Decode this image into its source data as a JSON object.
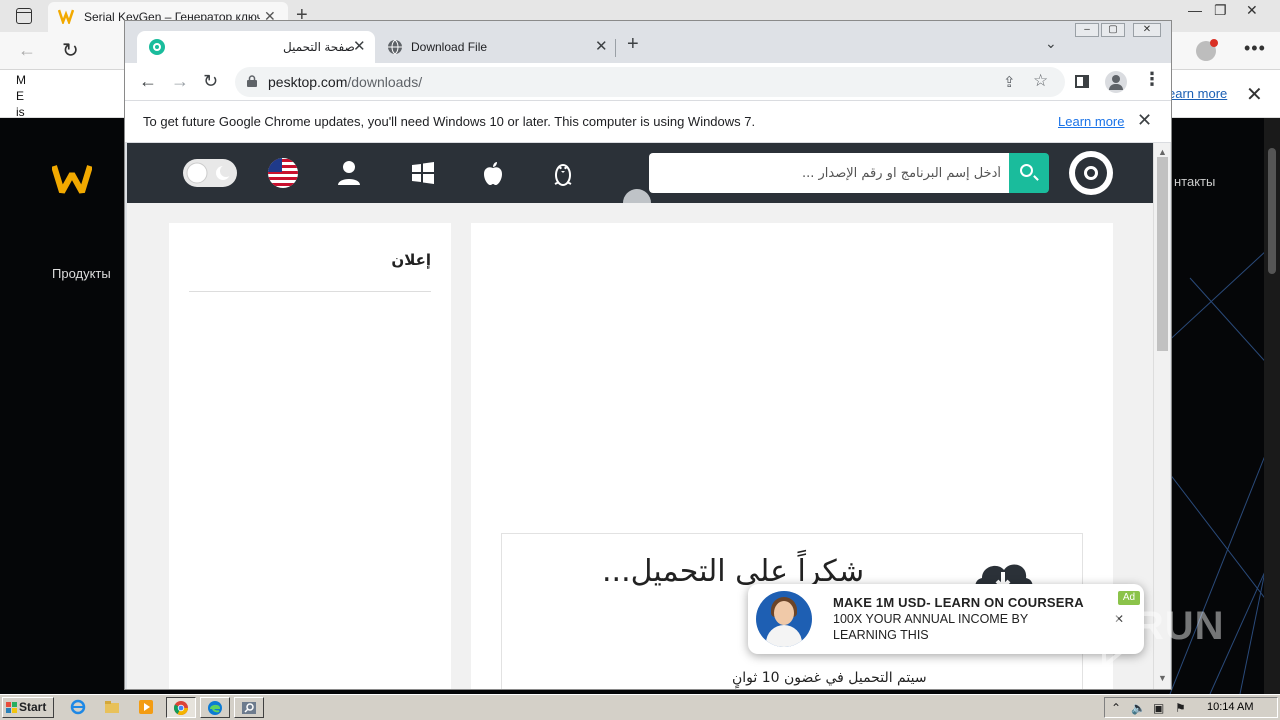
{
  "background_window": {
    "tab_title": "Serial KeyGen – Генератор ключ",
    "infobar_fragment": "M E is",
    "infobar_learn_more": "earn more",
    "nav_products": "Продукты",
    "nav_contacts": "нтакты"
  },
  "chrome": {
    "tabs": [
      {
        "title": "صفحة التحميل",
        "favicon": "pesktop-icon",
        "active": true
      },
      {
        "title": "Download File",
        "favicon": "globe-icon",
        "active": false
      }
    ],
    "url_domain": "pesktop.com",
    "url_path": "/downloads/",
    "infobar_text": "To get future Google Chrome updates, you'll need Windows 10 or later. This computer is using Windows 7.",
    "infobar_learn_more": "Learn more"
  },
  "site": {
    "search_placeholder": "أدخل إسم البرنامج او رقم الإصدار ...",
    "nav_icons": [
      "linux-icon",
      "apple-icon",
      "windows-icon",
      "user-icon",
      "us-flag-icon",
      "theme-toggle-icon"
    ],
    "ad_title": "إعلان",
    "thanks_text": "شكراً على التحميل...",
    "countdown_text": "سيتم التحميل في غضون 10 ثوانٍ",
    "accent_color": "#1abc9c"
  },
  "notification": {
    "title": "MAKE 1M USD- LEARN ON COURSERA",
    "body": "100X YOUR ANNUAL INCOME BY LEARNING THIS",
    "badge": "Ad"
  },
  "watermark": "ANY RUN",
  "taskbar": {
    "start_label": "Start",
    "clock": "10:14 AM"
  }
}
